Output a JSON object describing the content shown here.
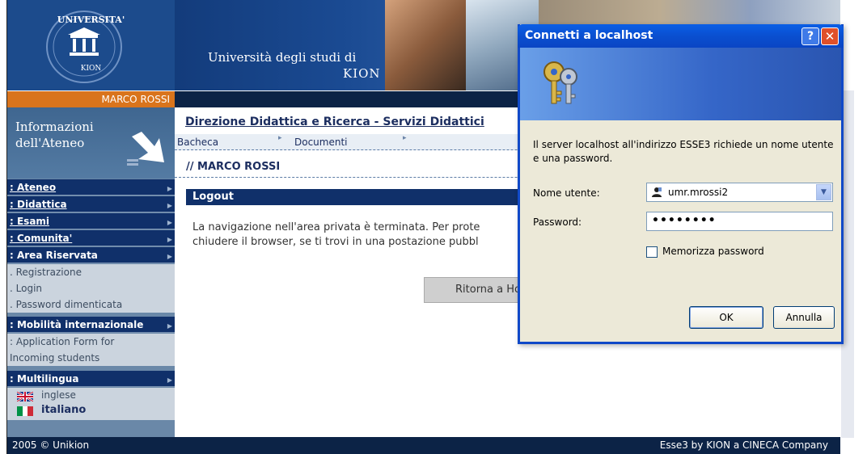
{
  "header": {
    "logo_uni": "UNIVERSITA'",
    "logo_kion": "KION",
    "title_line1": "Università degli studi di",
    "title_line2": "KION"
  },
  "user_bar": {
    "name": "MARCO ROSSI"
  },
  "sidebar": {
    "info_title_line1": "Informazioni",
    "info_title_line2": "dell'Ateneo",
    "menu": [
      {
        "label": ": Ateneo"
      },
      {
        "label": ": Didattica"
      },
      {
        "label": ": Esami"
      },
      {
        "label": ": Comunita'"
      },
      {
        "label": ": Area Riservata"
      }
    ],
    "area_items": [
      ". Registrazione",
      ". Login",
      ". Password dimenticata"
    ],
    "mobilita": ": Mobilità internazionale",
    "mobilita_items": [
      ": Application Form for",
      "Incoming students"
    ],
    "multilingua": ": Multilingua",
    "languages": [
      {
        "label": "inglese",
        "icon": "uk-flag-icon"
      },
      {
        "label": "italiano",
        "icon": "italy-flag-icon"
      }
    ]
  },
  "main": {
    "breadcrumb": "Direzione Didattica e Ricerca - Servizi Didattici",
    "tabs": [
      "Bacheca",
      "Documenti"
    ],
    "page_user": "// MARCO ROSSI",
    "section_title": "Logout",
    "logout_line1": "La navigazione nell'area privata è terminata. Per prote",
    "logout_line2": "chiudere il browser, se ti trovi in una postazione pubbl",
    "home_button": "Ritorna a Ho"
  },
  "footer": {
    "left": "2005 © Unikion",
    "right": "Esse3 by KION a CINECA Company"
  },
  "dialog": {
    "title": "Connetti a localhost",
    "help": "?",
    "close": "✕",
    "message": "Il server localhost all'indirizzo ESSE3 richiede un nome utente e una password.",
    "user_label": "Nome utente:",
    "user_value": "umr.mrossi2",
    "pass_label": "Password:",
    "pass_value": "••••••••",
    "remember_label": "Memorizza password",
    "ok": "OK",
    "cancel": "Annulla"
  },
  "colors": {
    "accent_orange": "#d9741c",
    "navy": "#10306a",
    "dialog_blue": "#0a4fd0"
  }
}
